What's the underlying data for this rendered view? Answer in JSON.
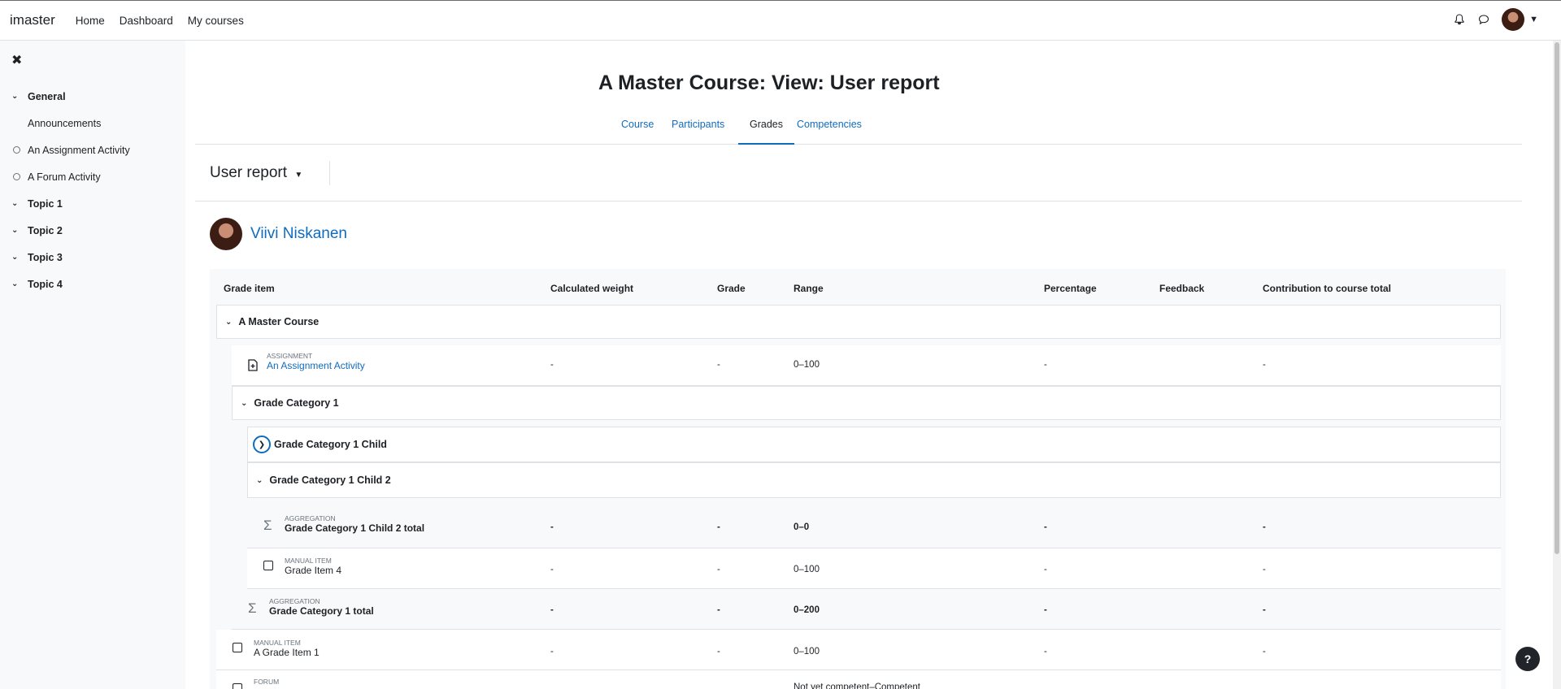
{
  "navbar": {
    "brand": "imaster",
    "links": [
      "Home",
      "Dashboard",
      "My courses"
    ],
    "icons": [
      "bell-icon",
      "chat-icon"
    ]
  },
  "drawer": {
    "items": [
      {
        "label": "General",
        "type": "section"
      },
      {
        "label": "Announcements",
        "type": "sub"
      },
      {
        "label": "An Assignment Activity",
        "type": "activity"
      },
      {
        "label": "A Forum Activity",
        "type": "activity"
      },
      {
        "label": "Topic 1",
        "type": "section"
      },
      {
        "label": "Topic 2",
        "type": "section"
      },
      {
        "label": "Topic 3",
        "type": "section"
      },
      {
        "label": "Topic 4",
        "type": "section"
      }
    ]
  },
  "page": {
    "title": "A Master Course: View: User report",
    "tabs": [
      "Course",
      "Participants",
      "Grades",
      "Competencies"
    ],
    "active_tab": "Grades",
    "report_select": "User report",
    "user_name": "Viivi Niskanen"
  },
  "table": {
    "headers": [
      "Grade item",
      "Calculated weight",
      "Grade",
      "Range",
      "Percentage",
      "Feedback",
      "Contribution to course total"
    ],
    "course_category": "A Master Course",
    "assignment": {
      "type": "ASSIGNMENT",
      "name": "An Assignment Activity",
      "weight": "-",
      "grade": "-",
      "range": "0–100",
      "percentage": "-",
      "contribution": "-"
    },
    "cat1": "Grade Category 1",
    "cat1_child": "Grade Category 1 Child",
    "cat1_child2": "Grade Category 1 Child 2",
    "child2_total": {
      "type": "AGGREGATION",
      "name": "Grade Category 1 Child 2 total",
      "weight": "-",
      "grade": "-",
      "range": "0–0",
      "percentage": "-",
      "contribution": "-"
    },
    "item4": {
      "type": "MANUAL ITEM",
      "name": "Grade Item 4",
      "weight": "-",
      "grade": "-",
      "range": "0–100",
      "percentage": "-",
      "contribution": "-"
    },
    "cat1_total": {
      "type": "AGGREGATION",
      "name": "Grade Category 1 total",
      "weight": "-",
      "grade": "-",
      "range": "0–200",
      "percentage": "-",
      "contribution": "-"
    },
    "item1": {
      "type": "MANUAL ITEM",
      "name": "A Grade Item 1",
      "weight": "-",
      "grade": "-",
      "range": "0–100",
      "percentage": "-",
      "contribution": "-"
    },
    "forum": {
      "type": "FORUM",
      "range": "Not yet competent–Competent"
    }
  },
  "help": "?"
}
